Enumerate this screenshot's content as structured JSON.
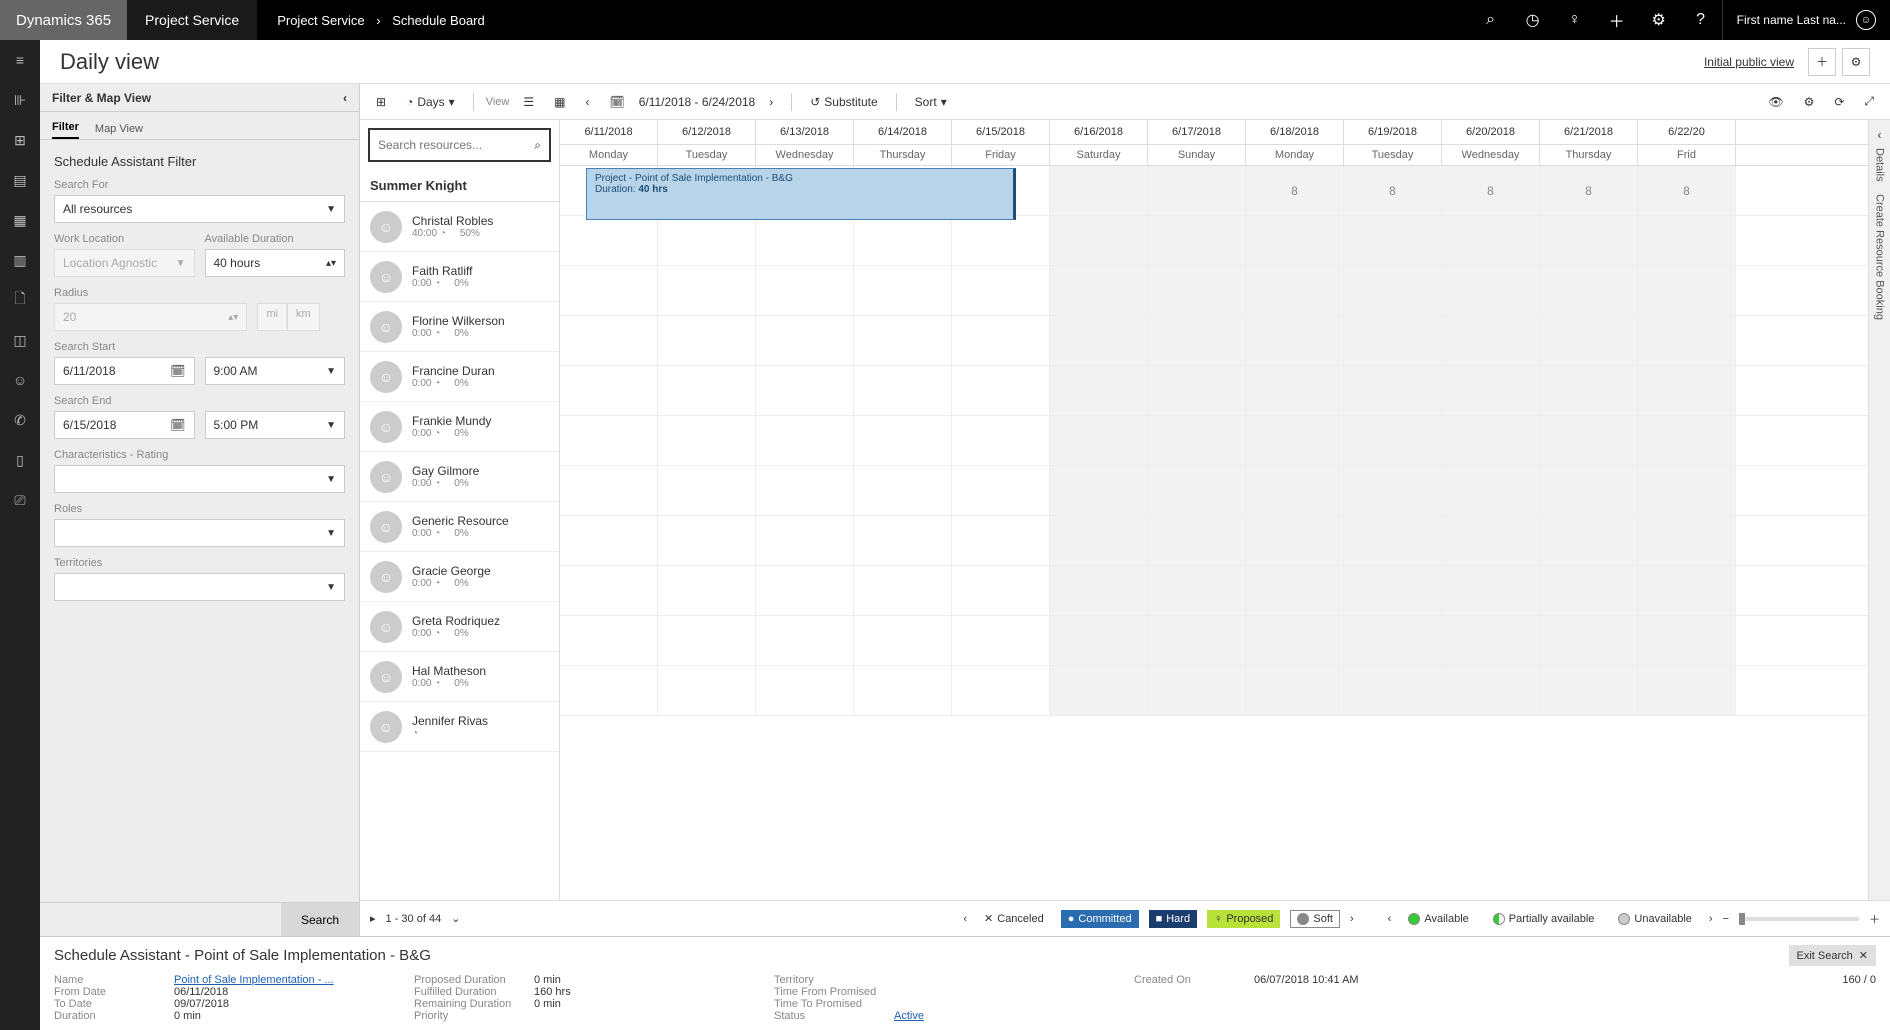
{
  "topbar": {
    "brand": "Dynamics 365",
    "module": "Project Service",
    "crumb1": "Project Service",
    "crumb2": "Schedule Board",
    "user": "First name Last na..."
  },
  "title": "Daily view",
  "titlebar": {
    "view_label": "Initial public view"
  },
  "filterpanel": {
    "header": "Filter & Map View",
    "tabs": {
      "filter": "Filter",
      "map": "Map View"
    },
    "assistant_title": "Schedule Assistant Filter",
    "search_for": "Search For",
    "search_for_val": "All resources",
    "work_location": "Work Location",
    "work_location_val": "Location Agnostic",
    "avail_dur": "Available Duration",
    "avail_dur_val": "40 hours",
    "radius": "Radius",
    "radius_val": "20",
    "unit_mi": "mi",
    "unit_km": "km",
    "search_start": "Search Start",
    "ss_date": "6/11/2018",
    "ss_time": "9:00 AM",
    "search_end": "Search End",
    "se_date": "6/15/2018",
    "se_time": "5:00 PM",
    "char": "Characteristics - Rating",
    "roles": "Roles",
    "territories": "Territories",
    "search_btn": "Search"
  },
  "toolbar": {
    "days": "Days",
    "view": "View",
    "range": "6/11/2018 - 6/24/2018",
    "substitute": "Substitute",
    "sort": "Sort"
  },
  "calendar": {
    "dates": [
      "6/11/2018",
      "6/12/2018",
      "6/13/2018",
      "6/14/2018",
      "6/15/2018",
      "6/16/2018",
      "6/17/2018",
      "6/18/2018",
      "6/19/2018",
      "6/20/2018",
      "6/21/2018",
      "6/22/20"
    ],
    "days": [
      "Monday",
      "Tuesday",
      "Wednesday",
      "Thursday",
      "Friday",
      "Saturday",
      "Sunday",
      "Monday",
      "Tuesday",
      "Wednesday",
      "Thursday",
      "Frid"
    ]
  },
  "summary_name": "Summer Knight",
  "resource_search_placeholder": "Search resources...",
  "resources": [
    {
      "name": "Christal Robles",
      "hours": "40:00",
      "pct": "50%"
    },
    {
      "name": "Faith Ratliff",
      "hours": "0:00",
      "pct": "0%"
    },
    {
      "name": "Florine Wilkerson",
      "hours": "0:00",
      "pct": "0%"
    },
    {
      "name": "Francine Duran",
      "hours": "0:00",
      "pct": "0%"
    },
    {
      "name": "Frankie Mundy",
      "hours": "0:00",
      "pct": "0%"
    },
    {
      "name": "Gay Gilmore",
      "hours": "0:00",
      "pct": "0%"
    },
    {
      "name": "Generic Resource",
      "hours": "0:00",
      "pct": "0%"
    },
    {
      "name": "Gracie George",
      "hours": "0:00",
      "pct": "0%"
    },
    {
      "name": "Greta Rodriquez",
      "hours": "0:00",
      "pct": "0%"
    },
    {
      "name": "Hal Matheson",
      "hours": "0:00",
      "pct": "0%"
    },
    {
      "name": "Jennifer Rivas",
      "hours": "",
      "pct": ""
    }
  ],
  "booking": {
    "line1": "Project - Point of Sale Implementation - B&G",
    "line2a": "Duration: ",
    "line2b": "40 hrs"
  },
  "row0_eights": "8",
  "paging": "1 - 30 of 44",
  "legend": {
    "canceled": "Canceled",
    "committed": "Committed",
    "hard": "Hard",
    "proposed": "Proposed",
    "soft": "Soft",
    "available": "Available",
    "partial": "Partially available",
    "unavail": "Unavailable"
  },
  "rightrail": {
    "details": "Details",
    "create": "Create Resource Booking"
  },
  "bottom": {
    "header": "Schedule Assistant - Point of Sale Implementation - B&G",
    "exit": "Exit Search",
    "name_l": "Name",
    "name_v": "Point of Sale Implementation - ...",
    "from_l": "From Date",
    "from_v": "06/11/2018",
    "to_l": "To Date",
    "to_v": "09/07/2018",
    "dur_l": "Duration",
    "dur_v": "0 min",
    "prop_l": "Proposed Duration",
    "prop_v": "0 min",
    "ful_l": "Fulfilled Duration",
    "ful_v": "160 hrs",
    "rem_l": "Remaining Duration",
    "rem_v": "0 min",
    "pri_l": "Priority",
    "pri_v": "",
    "terr_l": "Territory",
    "terr_v": "",
    "tfp_l": "Time From Promised",
    "tfp_v": "",
    "ttp_l": "Time To Promised",
    "ttp_v": "",
    "stat_l": "Status",
    "stat_v": "Active",
    "created_l": "Created On",
    "created_v": "06/07/2018 10:41 AM",
    "counter": "160 / 0"
  }
}
